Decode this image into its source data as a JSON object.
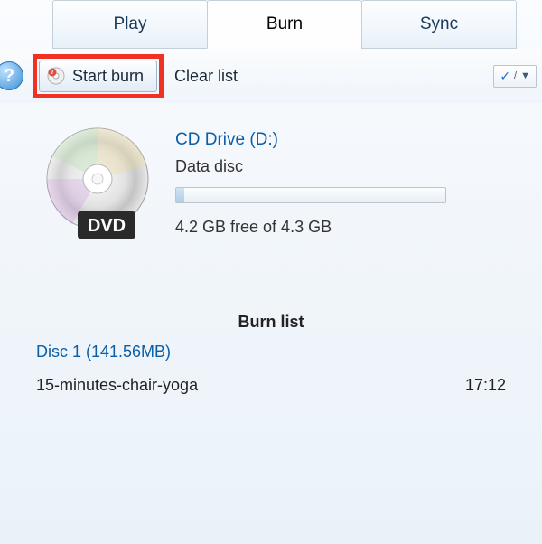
{
  "tabs": {
    "play": "Play",
    "burn": "Burn",
    "sync": "Sync"
  },
  "toolbar": {
    "start_burn": "Start burn",
    "clear_list": "Clear list"
  },
  "drive": {
    "title": "CD Drive (D:)",
    "disc_type": "Data disc",
    "free_space": "4.2 GB free of 4.3 GB"
  },
  "burn_list": {
    "header": "Burn list",
    "disc_label": "Disc 1 (141.56MB)"
  },
  "items": [
    {
      "name": "15-minutes-chair-yoga",
      "duration": "17:12"
    }
  ]
}
